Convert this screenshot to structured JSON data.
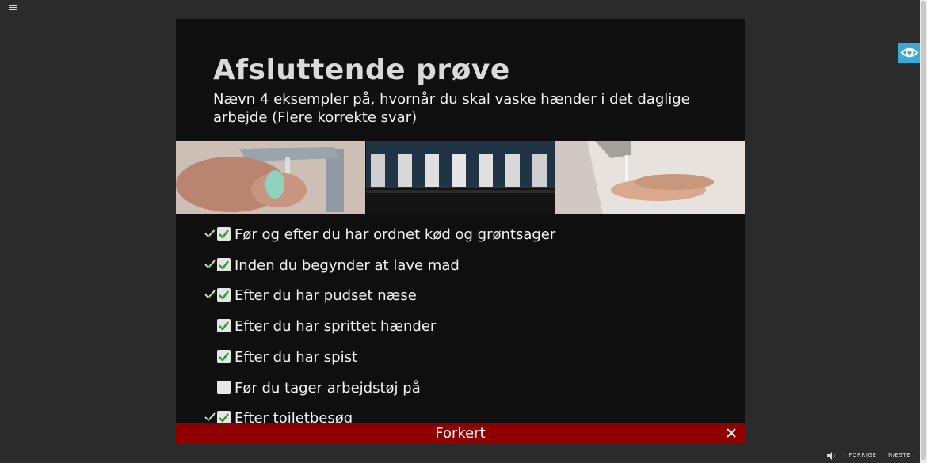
{
  "slide": {
    "title": "Afsluttende prøve",
    "question": "Nævn 4 eksempler på, hvornår du skal vaske hænder i det daglige arbejde (Flere korrekte svar)"
  },
  "images": [
    {
      "icon": "handwashing-soap-photo"
    },
    {
      "icon": "doors-hallway-photo"
    },
    {
      "icon": "handwashing-tap-photo"
    }
  ],
  "options": [
    {
      "label": "Før og efter du har ordnet kød og grøntsager",
      "checked": true,
      "correct_marker": true
    },
    {
      "label": "Inden du begynder at lave mad",
      "checked": true,
      "correct_marker": true
    },
    {
      "label": "Efter du har pudset næse",
      "checked": true,
      "correct_marker": true
    },
    {
      "label": "Efter du har sprittet hænder",
      "checked": true,
      "correct_marker": false
    },
    {
      "label": "Efter du har spist",
      "checked": true,
      "correct_marker": false
    },
    {
      "label": "Før du tager arbejdstøj på",
      "checked": false,
      "correct_marker": false
    },
    {
      "label": "Efter toiletbesøg",
      "checked": true,
      "correct_marker": true
    }
  ],
  "feedback": {
    "text": "Forkert",
    "color": "#8e0000"
  },
  "nav": {
    "prev_label": "FORRIGE",
    "next_label": "NÆSTE"
  },
  "colors": {
    "accent": "#3aa9d7",
    "check_green": "#2e9e2e",
    "slide_bg": "#0f0f0f"
  }
}
